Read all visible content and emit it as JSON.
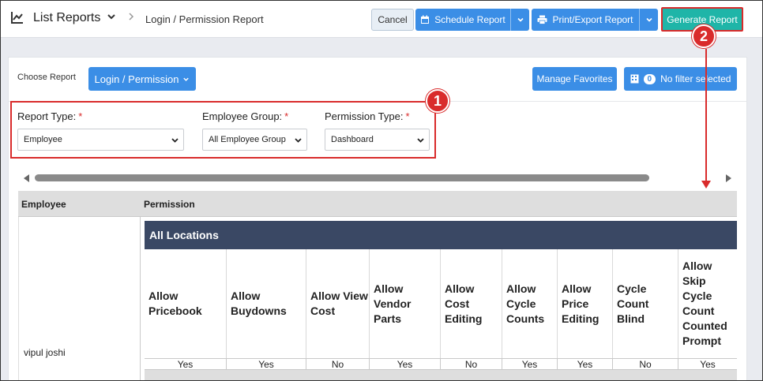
{
  "header": {
    "title": "List Reports",
    "breadcrumb": "Login / Permission Report",
    "icons": {
      "chart": "line-chart-icon",
      "chevron": "chevron-down-icon",
      "separator": "chevron-right-icon"
    }
  },
  "toolbar": {
    "cancel_label": "Cancel",
    "schedule_label": "Schedule Report",
    "print_label": "Print/Export Report",
    "generate_label": "Generate Report"
  },
  "report": {
    "choose_label": "Choose Report",
    "selected": "Login / Permission",
    "manage_favorites": "Manage Favorites",
    "filter_count": "0",
    "filter_text": "No filter selected"
  },
  "filters": {
    "report_type": {
      "label": "Report Type:",
      "value": "Employee"
    },
    "employee_group": {
      "label": "Employee Group:",
      "value": "All Employee Group"
    },
    "permission_type": {
      "label": "Permission Type:",
      "value": "Dashboard"
    },
    "required_mark": "*"
  },
  "annotations": {
    "marker1": "1",
    "marker2": "2"
  },
  "table": {
    "columns": [
      "Employee",
      "Permission"
    ],
    "employee": "vipul joshi",
    "location_header": "All Locations",
    "permissions": [
      {
        "label": "Allow Pricebook",
        "value": "Yes"
      },
      {
        "label": "Allow Buydowns",
        "value": "Yes"
      },
      {
        "label": "Allow View Cost",
        "value": "No"
      },
      {
        "label": "Allow Vendor Parts",
        "value": "Yes"
      },
      {
        "label": "Allow Cost Editing",
        "value": "No"
      },
      {
        "label": "Allow Cycle Counts",
        "value": "Yes"
      },
      {
        "label": "Allow Price Editing",
        "value": "Yes"
      },
      {
        "label": "Cycle Count Blind",
        "value": "No"
      },
      {
        "label": "Allow Skip Cycle Count Counted Prompt",
        "value": "Yes"
      }
    ]
  },
  "colors": {
    "accent_blue": "#3b8ee6",
    "generate_teal": "#1fb5a8",
    "annotation_red": "#d92b2b",
    "location_header": "#3a4864"
  }
}
